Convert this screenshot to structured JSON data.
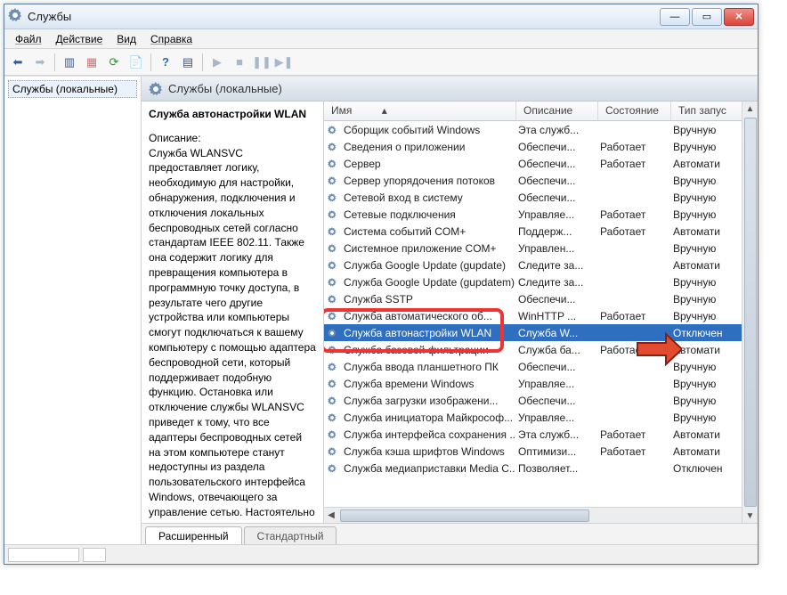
{
  "title": "Службы",
  "menu": {
    "file": "Файл",
    "action": "Действие",
    "view": "Вид",
    "help": "Справка"
  },
  "tree_root": "Службы (локальные)",
  "column_header": "Службы (локальные)",
  "detail": {
    "name": "Служба автонастройки WLAN",
    "desc_label": "Описание:",
    "desc": "Служба WLANSVC предоставляет логику, необходимую для настройки, обнаружения, подключения и отключения локальных беспроводных сетей согласно стандартам IEEE 802.11. Также она содержит логику для превращения компьютера в программную точку доступа, в результате чего другие устройства или компьютеры смогут подключаться к вашему компьютеру с помощью адаптера беспроводной сети, который поддерживает подобную функцию. Остановка или отключение службы WLANSVC приведет к тому, что все адаптеры беспроводных сетей на этом компьютере станут недоступны из раздела пользовательского интерфейса Windows, отвечающего за управление сетью. Настоятельно рекомендуется"
  },
  "list_headers": {
    "name": "Имя",
    "desc": "Описание",
    "state": "Состояние",
    "start": "Тип запус"
  },
  "rows": [
    {
      "name": "Сборщик событий Windows",
      "desc": "Эта служб...",
      "state": "",
      "start": "Вручную"
    },
    {
      "name": "Сведения о приложении",
      "desc": "Обеспечи...",
      "state": "Работает",
      "start": "Вручную"
    },
    {
      "name": "Сервер",
      "desc": "Обеспечи...",
      "state": "Работает",
      "start": "Автомати"
    },
    {
      "name": "Сервер упорядочения потоков",
      "desc": "Обеспечи...",
      "state": "",
      "start": "Вручную"
    },
    {
      "name": "Сетевой вход в систему",
      "desc": "Обеспечи...",
      "state": "",
      "start": "Вручную"
    },
    {
      "name": "Сетевые подключения",
      "desc": "Управляе...",
      "state": "Работает",
      "start": "Вручную"
    },
    {
      "name": "Система событий COM+",
      "desc": "Поддерж...",
      "state": "Работает",
      "start": "Автомати"
    },
    {
      "name": "Системное приложение COM+",
      "desc": "Управлен...",
      "state": "",
      "start": "Вручную"
    },
    {
      "name": "Служба Google Update (gupdate)",
      "desc": "Следите за...",
      "state": "",
      "start": "Автомати"
    },
    {
      "name": "Служба Google Update (gupdatem)",
      "desc": "Следите за...",
      "state": "",
      "start": "Вручную"
    },
    {
      "name": "Служба SSTP",
      "desc": "Обеспечи...",
      "state": "",
      "start": "Вручную"
    },
    {
      "name": "Служба автоматического об...",
      "desc": "WinHTTP ...",
      "state": "Работает",
      "start": "Вручную"
    },
    {
      "name": "Служба автонастройки WLAN",
      "desc": "Служба W...",
      "state": "",
      "start": "Отключен",
      "selected": true
    },
    {
      "name": "Служба базовой фильтрации",
      "desc": "Служба ба...",
      "state": "Работает",
      "start": "Автомати"
    },
    {
      "name": "Служба ввода планшетного ПК",
      "desc": "Обеспечи...",
      "state": "",
      "start": "Вручную"
    },
    {
      "name": "Служба времени Windows",
      "desc": "Управляе...",
      "state": "",
      "start": "Вручную"
    },
    {
      "name": "Служба загрузки изображени...",
      "desc": "Обеспечи...",
      "state": "",
      "start": "Вручную"
    },
    {
      "name": "Служба инициатора Майкрософ...",
      "desc": "Управляе...",
      "state": "",
      "start": "Вручную"
    },
    {
      "name": "Служба интерфейса сохранения ...",
      "desc": "Эта служб...",
      "state": "Работает",
      "start": "Автомати"
    },
    {
      "name": "Служба кэша шрифтов Windows",
      "desc": "Оптимизи...",
      "state": "Работает",
      "start": "Автомати"
    },
    {
      "name": "Служба медиаприставки Media C...",
      "desc": "Позволяет...",
      "state": "",
      "start": "Отключен"
    }
  ],
  "tabs": {
    "ext": "Расширенный",
    "std": "Стандартный"
  }
}
